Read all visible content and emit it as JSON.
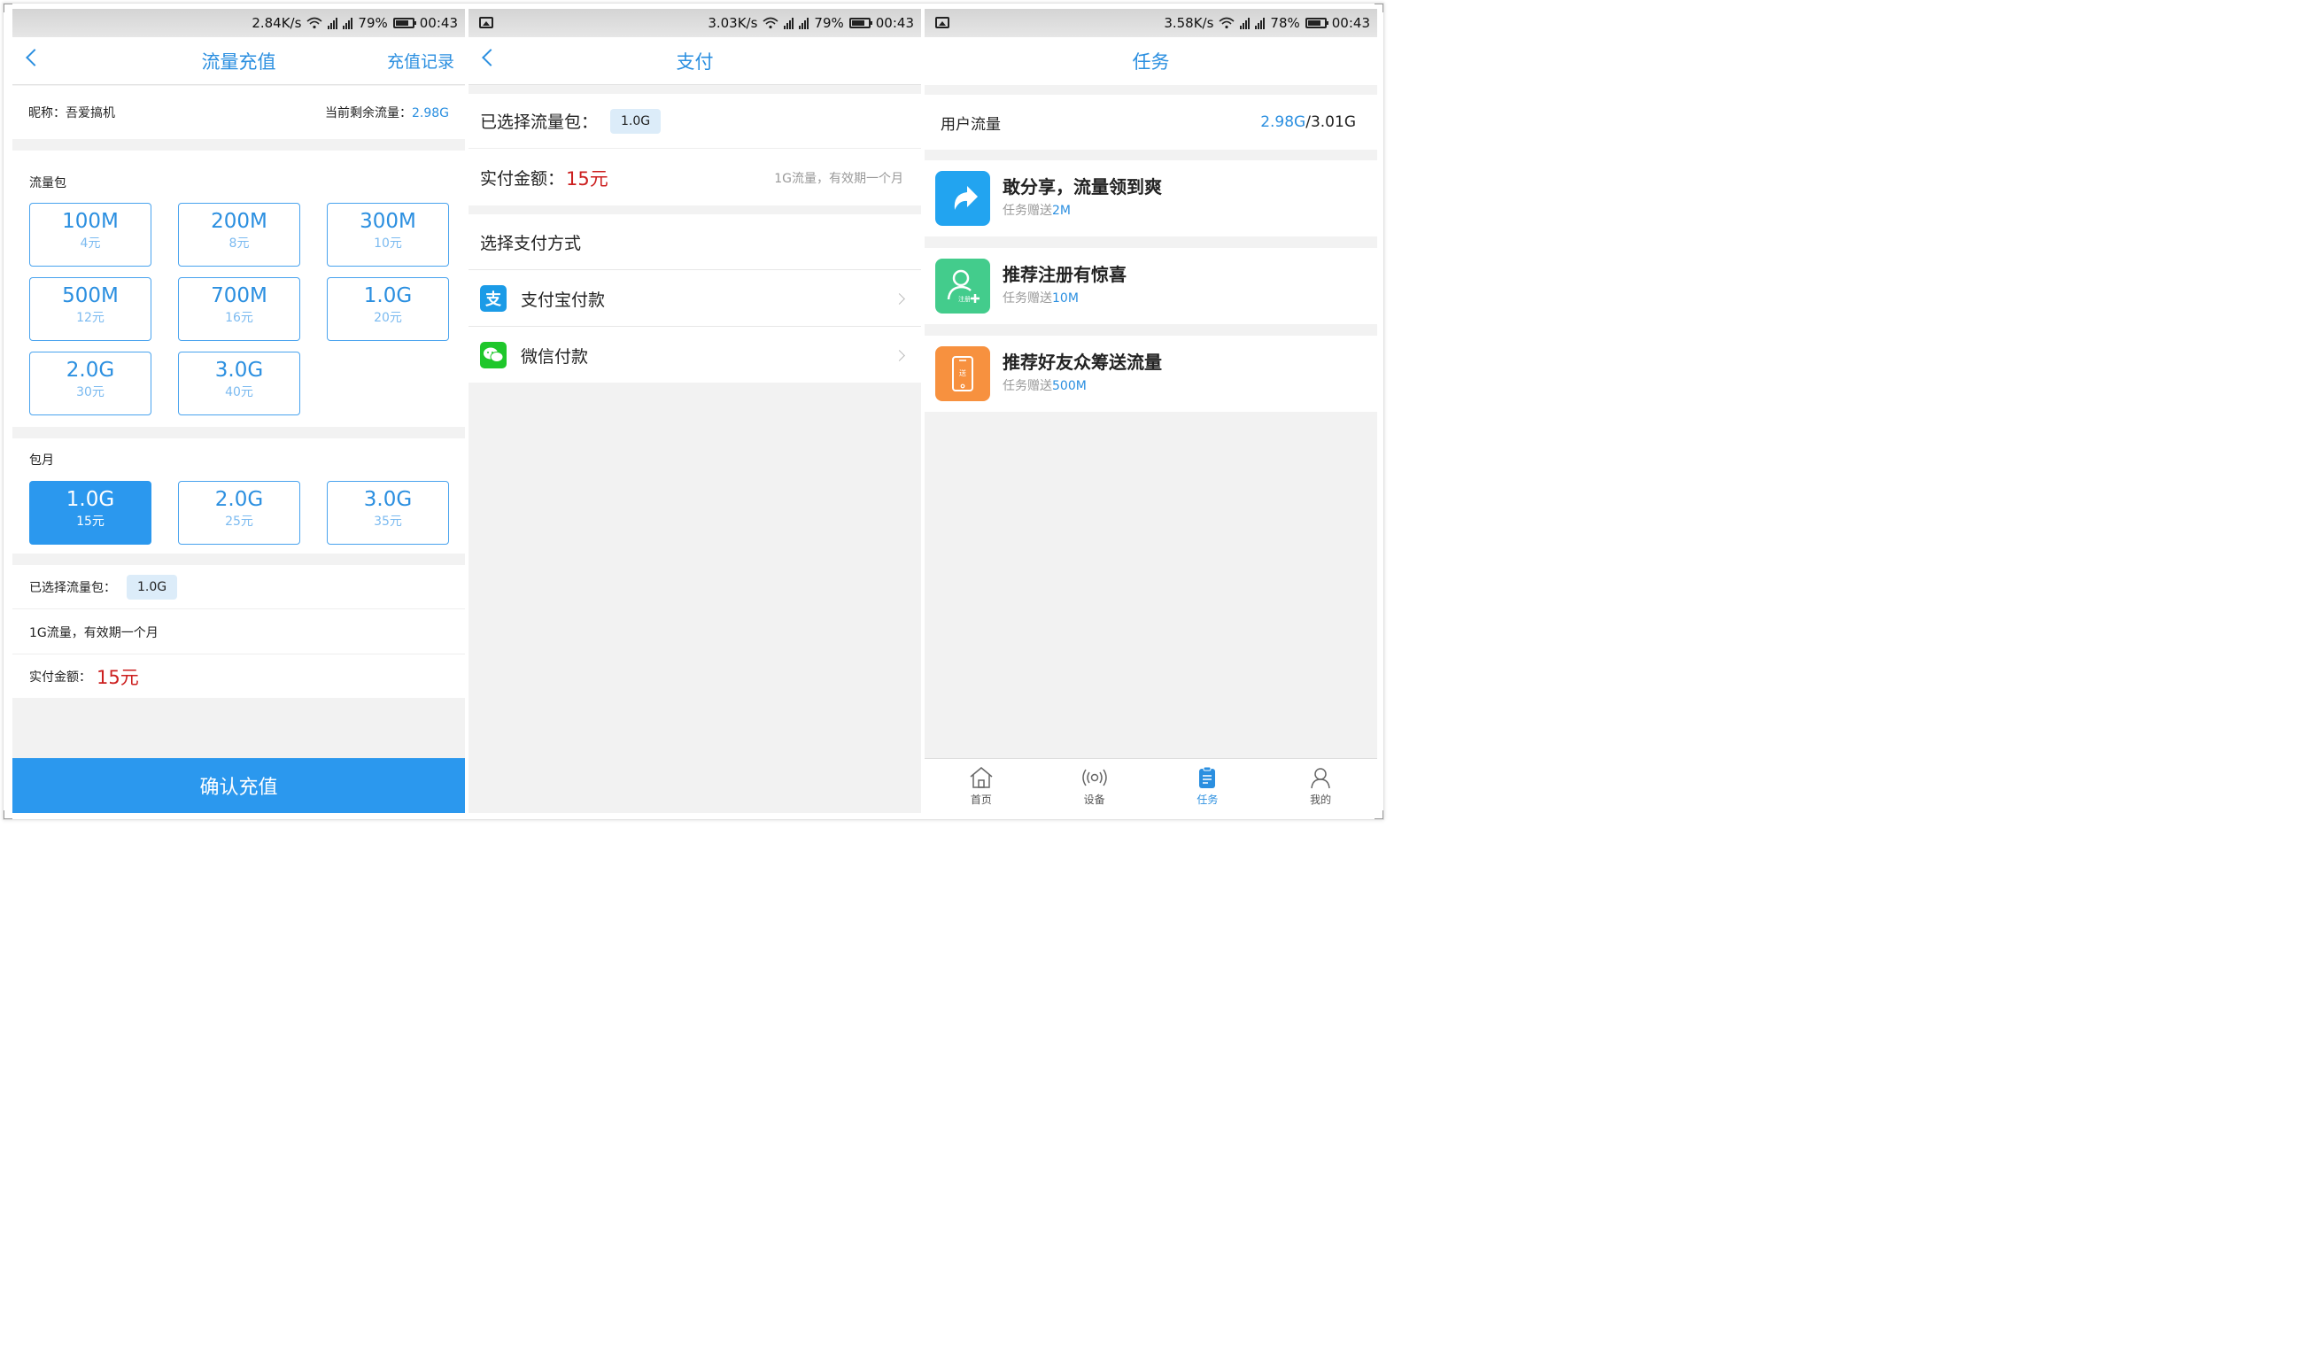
{
  "screens": {
    "recharge": {
      "status": {
        "speed": "2.84K/s",
        "battery": "79%",
        "time": "00:43"
      },
      "title": "流量充值",
      "right_link": "充值记录",
      "nickname_label": "昵称：吾爱搞机",
      "remaining_label": "当前剩余流量：",
      "remaining_value": "2.98G",
      "packages_label": "流量包",
      "packages": [
        {
          "size": "100M",
          "price": "4元"
        },
        {
          "size": "200M",
          "price": "8元"
        },
        {
          "size": "300M",
          "price": "10元"
        },
        {
          "size": "500M",
          "price": "12元"
        },
        {
          "size": "700M",
          "price": "16元"
        },
        {
          "size": "1.0G",
          "price": "20元"
        },
        {
          "size": "2.0G",
          "price": "30元"
        },
        {
          "size": "3.0G",
          "price": "40元"
        }
      ],
      "monthly_label": "包月",
      "monthly": [
        {
          "size": "1.0G",
          "price": "15元",
          "selected": true
        },
        {
          "size": "2.0G",
          "price": "25元",
          "selected": false
        },
        {
          "size": "3.0G",
          "price": "35元",
          "selected": false
        }
      ],
      "selected_label": "已选择流量包：",
      "selected_value": "1.0G",
      "description": "1G流量，有效期一个月",
      "amount_label": "实付金额：",
      "amount_value": "15元",
      "confirm_button": "确认充值"
    },
    "payment": {
      "status": {
        "speed": "3.03K/s",
        "battery": "79%",
        "time": "00:43"
      },
      "title": "支付",
      "selected_label": "已选择流量包：",
      "selected_value": "1.0G",
      "amount_label": "实付金额：",
      "amount_value": "15元",
      "description": "1G流量，有效期一个月",
      "method_label": "选择支付方式",
      "methods": [
        {
          "label": "支付宝付款",
          "icon": "alipay-icon",
          "color": "#1b9be7"
        },
        {
          "label": "微信付款",
          "icon": "wechat-icon",
          "color": "#1fc72b"
        }
      ]
    },
    "tasks": {
      "status": {
        "speed": "3.58K/s",
        "battery": "78%",
        "time": "00:43"
      },
      "title": "任务",
      "usage_label": "用户流量",
      "usage_used": "2.98G",
      "usage_total": "/3.01G",
      "items": [
        {
          "title": "敢分享，流量领到爽",
          "reward_prefix": "任务赠送",
          "reward": "2M",
          "icon": "share-icon",
          "color": "#22a4f0"
        },
        {
          "title": "推荐注册有惊喜",
          "reward_prefix": "任务赠送",
          "reward": "10M",
          "icon": "register-user-icon",
          "color": "#43cc8c",
          "icon_text": "注册"
        },
        {
          "title": "推荐好友众筹送流量",
          "reward_prefix": "任务赠送",
          "reward": "500M",
          "icon": "phone-gift-icon",
          "color": "#f7913f",
          "icon_text": "送"
        }
      ],
      "tabs": [
        {
          "label": "首页",
          "icon": "home-icon",
          "active": false
        },
        {
          "label": "设备",
          "icon": "device-signal-icon",
          "active": false
        },
        {
          "label": "任务",
          "icon": "task-clipboard-icon",
          "active": true
        },
        {
          "label": "我的",
          "icon": "user-profile-icon",
          "active": false
        }
      ]
    }
  },
  "colors": {
    "accent": "#2b98ee",
    "price_red": "#cc1f1f",
    "link_blue": "#2b8fe0"
  }
}
